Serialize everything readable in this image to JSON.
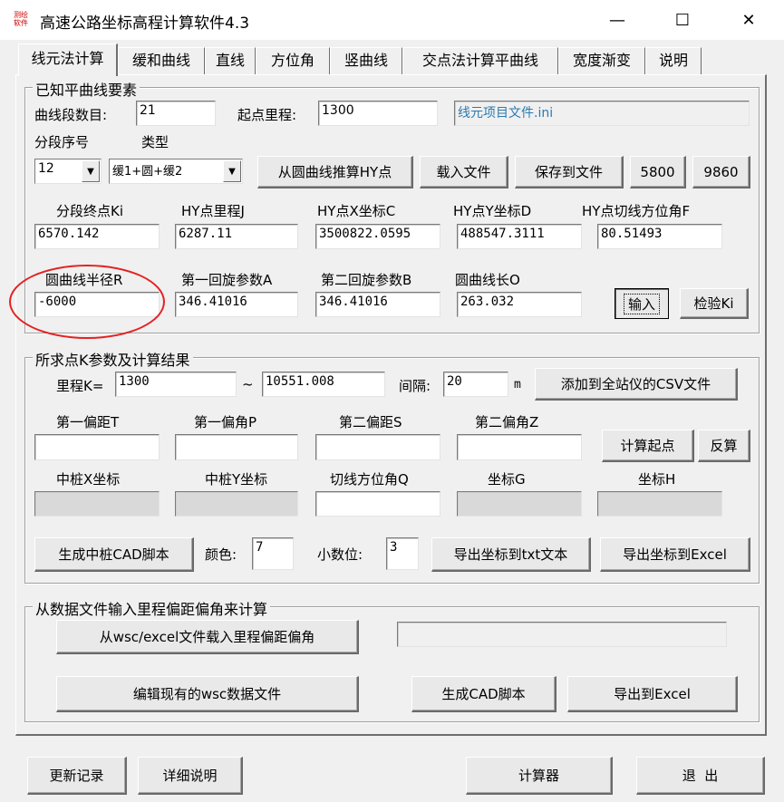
{
  "window": {
    "title": "高速公路坐标高程计算软件4.3",
    "icon_text": "测绘软件",
    "minimize_symbol": "—",
    "maximize_symbol": "☐",
    "close_symbol": "✕"
  },
  "tabs": [
    {
      "label": "线元法计算"
    },
    {
      "label": "缓和曲线"
    },
    {
      "label": "直线"
    },
    {
      "label": "方位角"
    },
    {
      "label": "竖曲线"
    },
    {
      "label": "交点法计算平曲线"
    },
    {
      "label": "宽度渐变"
    },
    {
      "label": "说明"
    }
  ],
  "known": {
    "group_title": "已知平曲线要素",
    "segment_count_label": "曲线段数目:",
    "segment_count": "21",
    "start_mileage_label": "起点里程:",
    "start_mileage": "1300",
    "project_file": "线元项目文件.ini",
    "segment_no_label": "分段序号",
    "type_label": "类型",
    "segment_no": "12",
    "type": "缓1+圆+缓2",
    "btn_hy": "从圆曲线推算HY点",
    "btn_load": "载入文件",
    "btn_save": "保存到文件",
    "btn_5800": "5800",
    "btn_9860": "9860",
    "col_ki": "分段终点Ki",
    "col_j": "HY点里程J",
    "col_c": "HY点X坐标C",
    "col_d": "HY点Y坐标D",
    "col_f": "HY点切线方位角F",
    "val_ki": "6570.142",
    "val_j": "6287.11",
    "val_c": "3500822.0595",
    "val_d": "488547.3111",
    "val_f": "80.51493",
    "col_r": "圆曲线半径R",
    "col_a": "第一回旋参数A",
    "col_b": "第二回旋参数B",
    "col_o": "圆曲线长O",
    "val_r": "-6000",
    "val_a": "346.41016",
    "val_b": "346.41016",
    "val_o": "263.032",
    "btn_input": "输入",
    "btn_check": "检验Ki"
  },
  "calc": {
    "group_title": "所求点K参数及计算结果",
    "k_label": "里程K=",
    "k_from": "1300",
    "tilde": "~",
    "k_to": "10551.008",
    "interval_label": "间隔:",
    "interval": "20",
    "unit_m": "m",
    "btn_csv": "添加到全站仪的CSV文件",
    "col_t": "第一偏距T",
    "col_p": "第一偏角P",
    "col_s": "第二偏距S",
    "col_z": "第二偏角Z",
    "btn_start": "计算起点",
    "btn_reverse": "反算",
    "col_x": "中桩X坐标",
    "col_y": "中桩Y坐标",
    "col_q": "切线方位角Q",
    "col_g": "坐标G",
    "col_h": "坐标H",
    "btn_cad": "生成中桩CAD脚本",
    "color_label": "颜色:",
    "color_val": "7",
    "decimal_label": "小数位:",
    "decimal_val": "3",
    "btn_txt": "导出坐标到txt文本",
    "btn_excel": "导出坐标到Excel"
  },
  "file": {
    "group_title": "从数据文件输入里程偏距偏角来计算",
    "btn_load_wsc": "从wsc/excel文件载入里程偏距偏角",
    "btn_edit_wsc": "编辑现有的wsc数据文件",
    "btn_cad": "生成CAD脚本",
    "btn_excel": "导出到Excel"
  },
  "bottom": {
    "btn_log": "更新记录",
    "btn_detail": "详细说明",
    "btn_calc": "计算器",
    "btn_exit": "退  出"
  },
  "colors": {
    "highlight_circle": "#e32222",
    "link_text": "#2a7ab0"
  }
}
